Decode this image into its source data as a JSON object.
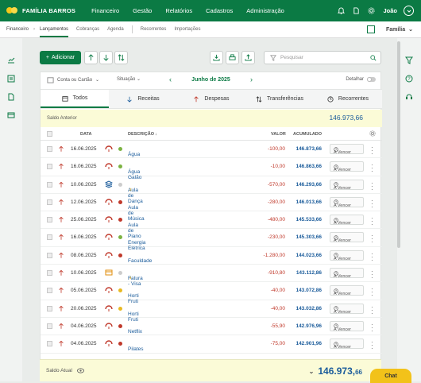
{
  "topbar": {
    "brand": "FAMÍLIA BARROS",
    "nav": [
      "Financeiro",
      "Gestão",
      "Relatórios",
      "Cadastros",
      "Administração"
    ],
    "user": "João"
  },
  "subbar": {
    "crumb": "Financeiro",
    "active": "Lançamentos",
    "items": [
      "Cobranças",
      "Agenda",
      "Recorrentes",
      "Importações"
    ],
    "family": "Família"
  },
  "toolbar": {
    "add_label": "Adicionar",
    "search_placeholder": "Pesquisar"
  },
  "filters": {
    "account": "Conta ou Cartão",
    "situation": "Situação",
    "month": "Junho de 2025",
    "detail": "Detalhar"
  },
  "tabs": [
    "Todos",
    "Receitas",
    "Despesas",
    "Transferências",
    "Recorrentes"
  ],
  "saldo_anterior": {
    "label": "Saldo Anterior",
    "value": "146.973,66"
  },
  "columns": {
    "data": "DATA",
    "descricao": "DESCRIÇÃO",
    "valor": "VALOR",
    "acumulado": "ACUMULADO"
  },
  "rows": [
    {
      "date": "16.06.2025",
      "desc": "Água",
      "sup": "",
      "valor": "-100,00",
      "acum": "146.873,66",
      "status": "A Vencer",
      "dot": "#7cb342",
      "icon": "pig-icon"
    },
    {
      "date": "16.06.2025",
      "desc": "Água Galão",
      "sup": "",
      "valor": "-10,00",
      "acum": "146.863,66",
      "status": "A Vencer",
      "dot": "#7cb342",
      "icon": "pig-icon"
    },
    {
      "date": "10.06.2025",
      "desc": "Aula de Dança",
      "sup": "2",
      "valor": "-570,00",
      "acum": "146.293,66",
      "status": "A Vencer",
      "dot": "#cccccc",
      "icon": "stack-icon"
    },
    {
      "date": "12.06.2025",
      "desc": "Aula de Música",
      "sup": "",
      "valor": "-280,00",
      "acum": "146.013,66",
      "status": "A Vencer",
      "dot": "#c0392b",
      "icon": "pig-icon"
    },
    {
      "date": "25.06.2025",
      "desc": "Aula de Piano",
      "sup": "",
      "valor": "-480,00",
      "acum": "145.533,66",
      "status": "A Vencer",
      "dot": "#c0392b",
      "icon": "pig-icon"
    },
    {
      "date": "16.06.2025",
      "desc": "Energia Elétrica",
      "sup": "",
      "valor": "-230,00",
      "acum": "145.303,66",
      "status": "A Vencer",
      "dot": "#7cb342",
      "icon": "pig-icon"
    },
    {
      "date": "08.06.2025",
      "desc": "Faculdade",
      "sup": "",
      "valor": "-1.280,00",
      "acum": "144.023,66",
      "status": "A Vencer",
      "dot": "#c0392b",
      "icon": "pig-icon"
    },
    {
      "date": "10.06.2025",
      "desc": "Fatura - Visa",
      "sup": "4",
      "valor": "-910,80",
      "acum": "143.112,86",
      "status": "A Vencer",
      "dot": "#cccccc",
      "icon": "card-icon"
    },
    {
      "date": "05.06.2025",
      "desc": "Horti Fruti",
      "sup": "",
      "valor": "-40,00",
      "acum": "143.072,86",
      "status": "A Vencer",
      "dot": "#e8b923",
      "icon": "pig-icon"
    },
    {
      "date": "20.06.2025",
      "desc": "Horti Fruti",
      "sup": "",
      "valor": "-40,00",
      "acum": "143.032,86",
      "status": "A Vencer",
      "dot": "#e8b923",
      "icon": "pig-icon"
    },
    {
      "date": "04.06.2025",
      "desc": "Netflix",
      "sup": "",
      "valor": "-55,90",
      "acum": "142.976,96",
      "status": "A Vencer",
      "dot": "#c0392b",
      "icon": "pig-icon"
    },
    {
      "date": "04.06.2025",
      "desc": "Pilates",
      "sup": "",
      "valor": "-75,00",
      "acum": "142.901,96",
      "status": "A Vencer",
      "dot": "#c0392b",
      "icon": "pig-icon"
    }
  ],
  "footer": {
    "label": "Saldo Atual",
    "value_main": "146.973,",
    "value_dec": "66"
  },
  "chat": "Chat",
  "colors": {
    "brand_green": "#0b7a44",
    "accent_yellow": "#f2c21a",
    "link_blue": "#1b5c9b",
    "negative_red": "#c0392b"
  }
}
